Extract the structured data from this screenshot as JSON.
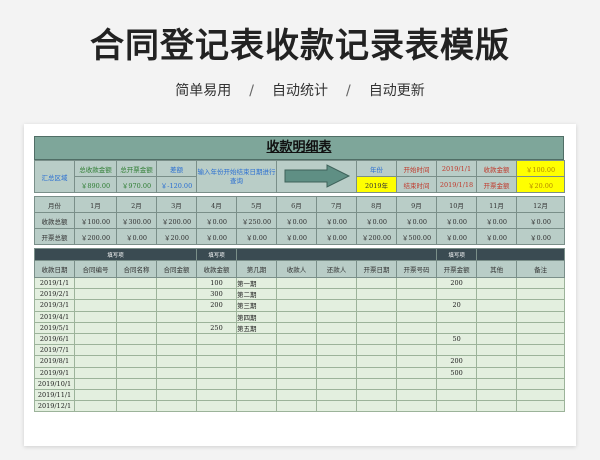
{
  "title": "合同登记表收款记录表模版",
  "subtitle": [
    "简单易用",
    "自动统计",
    "自动更新"
  ],
  "sheet": {
    "banner": "收款明细表",
    "summary": {
      "label": "汇总区域",
      "total_receipt_label": "总收款金额",
      "total_receipt_value": "￥890.00",
      "total_invoice_label": "总开票金额",
      "total_invoice_value": "￥970.00",
      "diff_label": "差额",
      "diff_value": "￥-120.00",
      "hint": "输入年份开始结束日期进行查询",
      "year_label": "年份",
      "year_value": "2019年",
      "start_label": "开始时间",
      "start_value": "2019/1/1",
      "end_label": "结束时间",
      "end_value": "2019/1/18",
      "receipt_amount_label": "收款金额",
      "receipt_amount_value": "￥100.00",
      "invoice_amount_label": "开票金额",
      "invoice_amount_value": "￥20.00"
    },
    "monthly": {
      "header": [
        "月份",
        "1月",
        "2月",
        "3月",
        "4月",
        "5月",
        "6月",
        "7月",
        "8月",
        "9月",
        "10月",
        "11月",
        "12月"
      ],
      "rows": [
        [
          "收款总额",
          "￥100.00",
          "￥300.00",
          "￥200.00",
          "￥0.00",
          "￥250.00",
          "￥0.00",
          "￥0.00",
          "￥0.00",
          "￥0.00",
          "￥0.00",
          "￥0.00",
          "￥0.00"
        ],
        [
          "开票总额",
          "￥200.00",
          "￥0.00",
          "￥20.00",
          "￥0.00",
          "￥0.00",
          "￥0.00",
          "￥0.00",
          "￥200.00",
          "￥500.00",
          "￥0.00",
          "￥0.00",
          "￥0.00"
        ]
      ]
    },
    "fill_notes": [
      "填写项",
      "填写项",
      "填写项"
    ],
    "columns": [
      "收款日期",
      "合同编号",
      "合同名称",
      "合同金额",
      "收款金额",
      "第几期",
      "收款人",
      "还款人",
      "开票日期",
      "开票号码",
      "开票金额",
      "其他",
      "备注"
    ],
    "rows": [
      {
        "date": "2019/1/1",
        "receipt": "100",
        "period": "第一期",
        "invoice": "200"
      },
      {
        "date": "2019/2/1",
        "receipt": "300",
        "period": "第二期",
        "invoice": ""
      },
      {
        "date": "2019/3/1",
        "receipt": "200",
        "period": "第三期",
        "invoice": "20"
      },
      {
        "date": "2019/4/1",
        "receipt": "",
        "period": "第四期",
        "invoice": ""
      },
      {
        "date": "2019/5/1",
        "receipt": "250",
        "period": "第五期",
        "invoice": ""
      },
      {
        "date": "2019/6/1",
        "receipt": "",
        "period": "",
        "invoice": "50"
      },
      {
        "date": "2019/7/1",
        "receipt": "",
        "period": "",
        "invoice": ""
      },
      {
        "date": "2019/8/1",
        "receipt": "",
        "period": "",
        "invoice": "200"
      },
      {
        "date": "2019/9/1",
        "receipt": "",
        "period": "",
        "invoice": "500"
      },
      {
        "date": "2019/10/1",
        "receipt": "",
        "period": "",
        "invoice": ""
      },
      {
        "date": "2019/11/1",
        "receipt": "",
        "period": "",
        "invoice": ""
      },
      {
        "date": "2019/12/1",
        "receipt": "",
        "period": "",
        "invoice": ""
      }
    ],
    "colors": {
      "header_bg": "#b9cdc7",
      "data_bg": "#e3efdf",
      "dark_bar": "#3a4b52",
      "highlight": "#ffff00",
      "arrow": "#5f8f84"
    }
  }
}
